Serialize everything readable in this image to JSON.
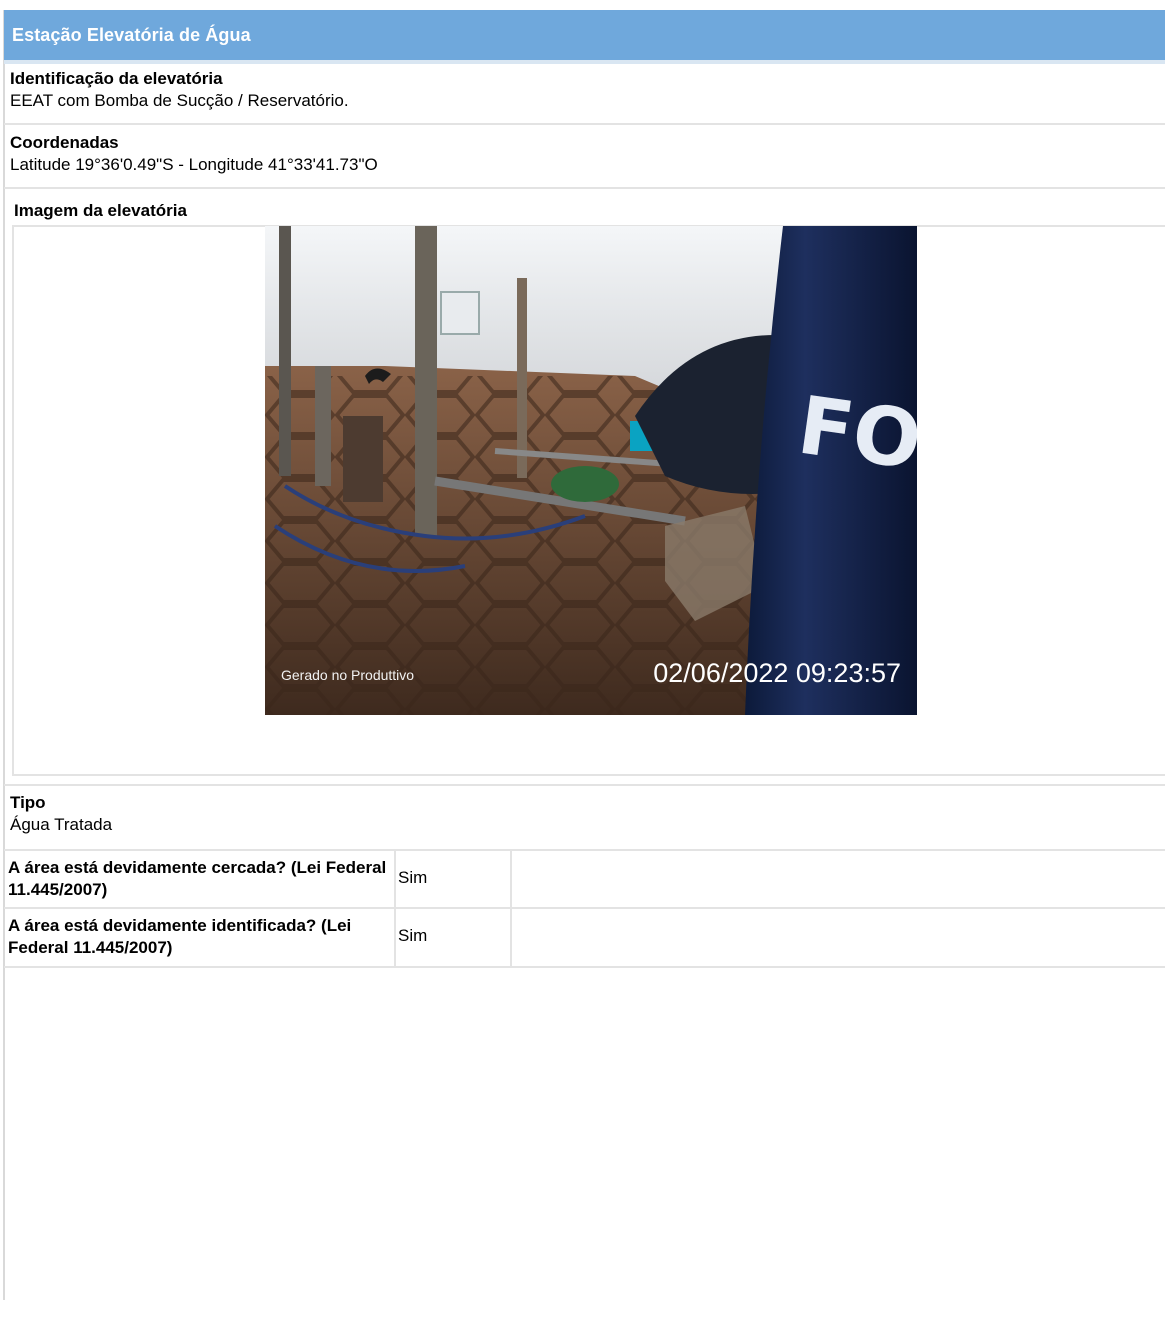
{
  "header": {
    "title": "Estação Elevatória de Água"
  },
  "identificacao": {
    "label": "Identificação da elevatória",
    "value": "EEAT com Bomba de Sucção / Reservatório."
  },
  "coordenadas": {
    "label": "Coordenadas",
    "value": "Latitude 19°36'0.49\"S - Longitude 41°33'41.73\"O"
  },
  "imagem": {
    "label": "Imagem da elevatória",
    "stamp_left": "Gerado no Produttivo",
    "stamp_right": "02/06/2022 09:23:57",
    "tank_text": "FORT"
  },
  "tipo": {
    "label": "Tipo",
    "value": "Água Tratada"
  },
  "questions": [
    {
      "question": "A área está devidamente cercada? (Lei Federal 11.445/2007)",
      "answer": "Sim"
    },
    {
      "question": "A área está devidamente identificada? (Lei Federal 11.445/2007)",
      "answer": "Sim"
    }
  ],
  "colors": {
    "header_bg": "#6fa8dc",
    "header_text": "#ffffff",
    "divider": "#e3e3e3"
  }
}
